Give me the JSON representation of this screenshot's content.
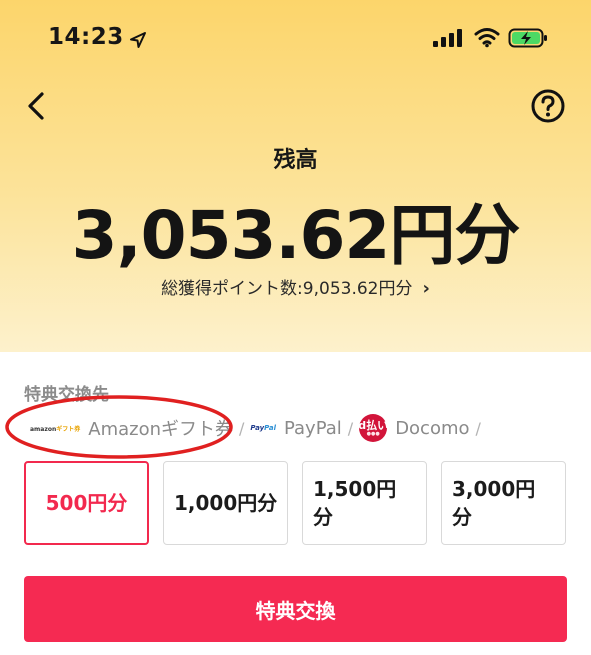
{
  "status_bar": {
    "time": "14:23",
    "location_icon": "location-arrow-icon",
    "signal_icon": "cellular-signal-icon",
    "wifi_icon": "wifi-icon",
    "battery_icon": "battery-charging-icon"
  },
  "header": {
    "back_icon": "chevron-left-icon",
    "help_icon": "question-circle-icon"
  },
  "balance": {
    "label": "残高",
    "amount": "3,053.62円分",
    "total_points": "総獲得ポイント数:9,053.62円分",
    "chevron": "›"
  },
  "rewards": {
    "section_title": "特典交換先",
    "destinations": [
      {
        "label": "Amazonギフト券",
        "logo": "amazon-logo"
      },
      {
        "label": "PayPal",
        "logo": "paypal-logo"
      },
      {
        "label": "Docomo",
        "logo": "docomo-logo"
      }
    ],
    "separator": "/",
    "amazon_logo_text": "amazon",
    "amazon_logo_sub": "ギフト券",
    "paypal_logo_text": "Pay",
    "paypal_logo_sub": "Pal",
    "docomo_logo_text": "d払い",
    "options": [
      {
        "label": "500円分",
        "selected": true
      },
      {
        "label": "1,000円分",
        "selected": false
      },
      {
        "label": "1,500円分",
        "selected": false
      },
      {
        "label": "3,000円分",
        "selected": false
      }
    ],
    "submit_label": "特典交換"
  },
  "colors": {
    "accent": "#f52a52",
    "hero_top": "#fcd56b",
    "annotation": "#e02020"
  }
}
